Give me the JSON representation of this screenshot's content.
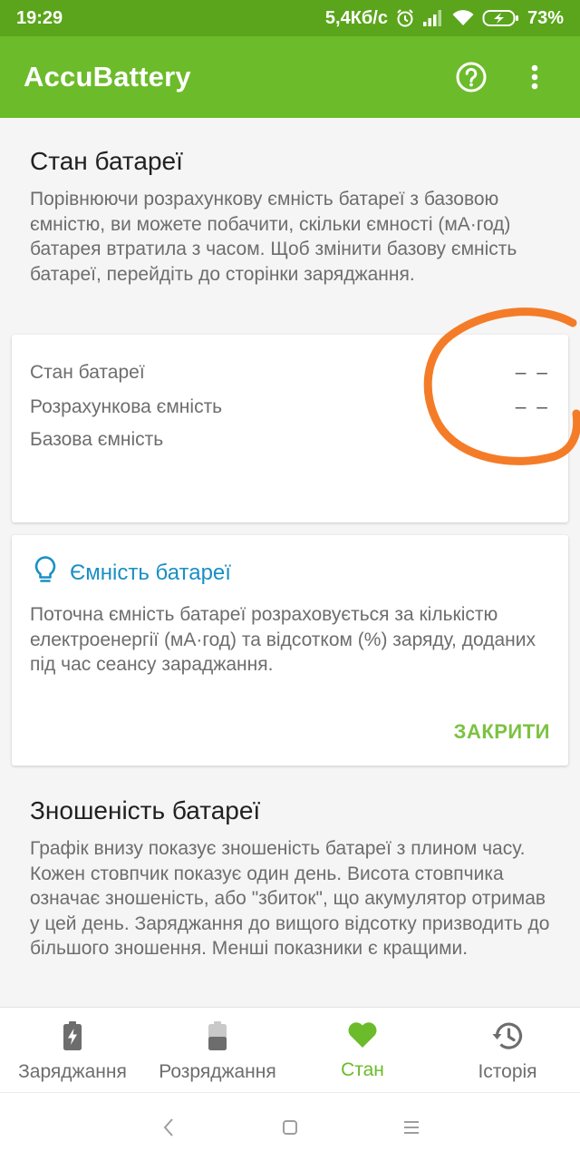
{
  "status_bar": {
    "time": "19:29",
    "speed": "5,4Кб/с",
    "battery_pct": "73%",
    "icons": [
      "alarm-icon",
      "signal-icon",
      "wifi-icon",
      "battery-charging-icon"
    ]
  },
  "app_bar": {
    "title": "AccuBattery",
    "icons": [
      "help-icon",
      "more-vert-icon"
    ]
  },
  "health_section": {
    "title": "Стан батареї",
    "description": "Порівнюючи розрахункову ємність батареї з базовою ємністю, ви можете побачити, скільки ємності (мА·год) батарея втратила з часом. Щоб змінити базову ємність батареї, перейдіть до сторінки заряджання."
  },
  "stats_card": {
    "rows": [
      {
        "label": "Стан батареї",
        "value": "– –"
      },
      {
        "label": "Розрахункова ємність",
        "value": "– –"
      },
      {
        "label": "Базова ємність",
        "value": ""
      }
    ]
  },
  "tip_card": {
    "icon": "lightbulb-icon",
    "title": "Ємність батареї",
    "text": "Поточна ємність батареї розраховується за кількістю електроенергії (мА·год) та відсотком (%) заряду, доданих під час сеансу зараджання.",
    "close_label": "ЗАКРИТИ"
  },
  "wear_section": {
    "title": "Зношеність батареї",
    "description": "Графік внизу показує зношеність батареї з плином часу. Кожен стовпчик показує один день. Висота стовпчика означає зношеність, або \"збиток\", що акумулятор отримав у цей день. Заряджання до вищого відсотку призводить до більшого зношення. Менші показники є кращими."
  },
  "bottom_nav": {
    "items": [
      {
        "label": "Заряджання",
        "icon": "battery-charging-icon"
      },
      {
        "label": "Розряджання",
        "icon": "battery-discharging-icon"
      },
      {
        "label": "Стан",
        "icon": "heart-icon",
        "active": true
      },
      {
        "label": "Історія",
        "icon": "history-icon"
      }
    ]
  },
  "colors": {
    "status_bar": "#5aa51b",
    "app_bar": "#6cbb2a",
    "accent_green": "#7cc242",
    "tip_blue": "#1a8fc4",
    "annotation_orange": "#f47c28"
  },
  "system_nav": {
    "icons": [
      "back-icon",
      "home-icon",
      "menu-icon"
    ]
  }
}
